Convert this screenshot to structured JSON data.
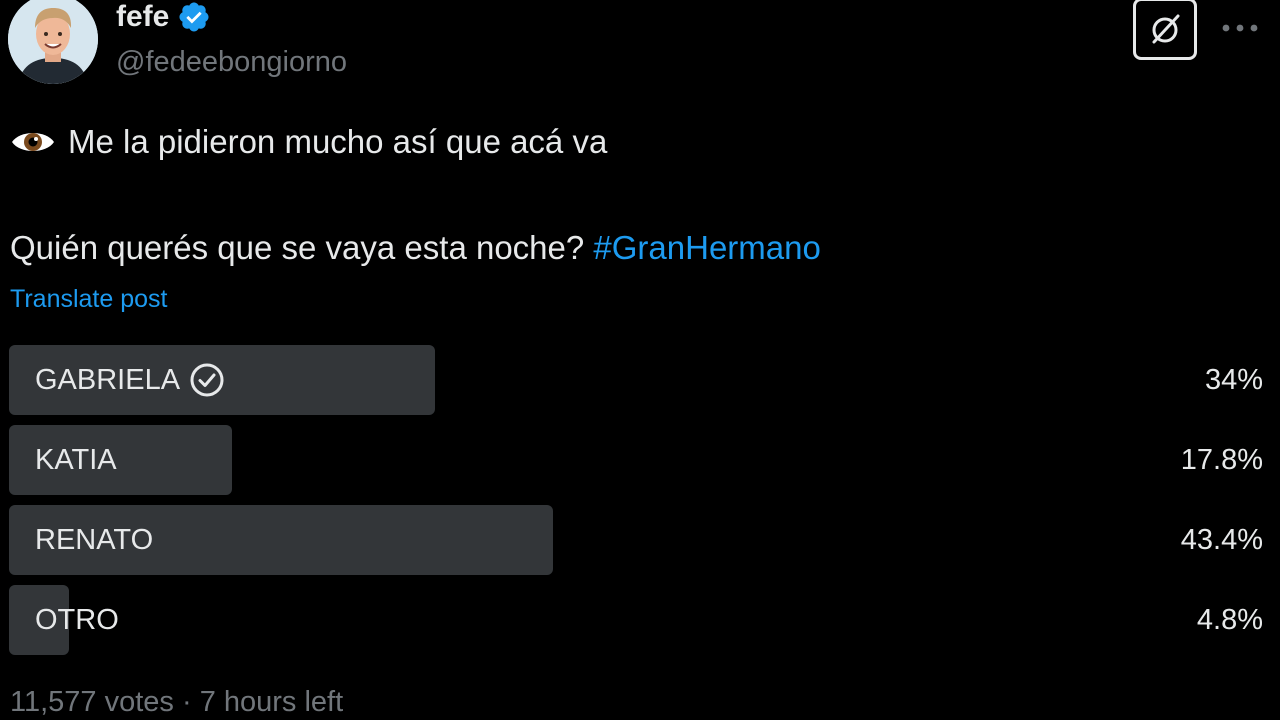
{
  "author": {
    "display_name": "fefe",
    "handle": "@fedeebongiorno",
    "verified_color": "#1d9bf0",
    "avatar_icon": "profile-photo"
  },
  "header_actions": {
    "grok_icon": "grok-icon",
    "more_icon": "more-icon"
  },
  "post": {
    "emoji": "👁",
    "line1": "Me la pidieron mucho así que acá va",
    "line2": "Quién querés que se vaya esta noche?",
    "hashtag": "#GranHermano",
    "translate": "Translate post"
  },
  "poll": {
    "options": [
      {
        "label": "GABRIELA",
        "percent_text": "34%",
        "percent": 34,
        "selected": true
      },
      {
        "label": "KATIA",
        "percent_text": "17.8%",
        "percent": 17.8,
        "selected": false
      },
      {
        "label": "RENATO",
        "percent_text": "43.4%",
        "percent": 43.4,
        "selected": false
      },
      {
        "label": "OTRO",
        "percent_text": "4.8%",
        "percent": 4.8,
        "selected": false
      }
    ],
    "votes": "11,577 votes",
    "separator": " · ",
    "time_left": "7 hours left"
  },
  "colors": {
    "background": "#000000",
    "text": "#e7e9ea",
    "muted": "#71767b",
    "link": "#1d9bf0",
    "poll_bar": "#333639"
  }
}
